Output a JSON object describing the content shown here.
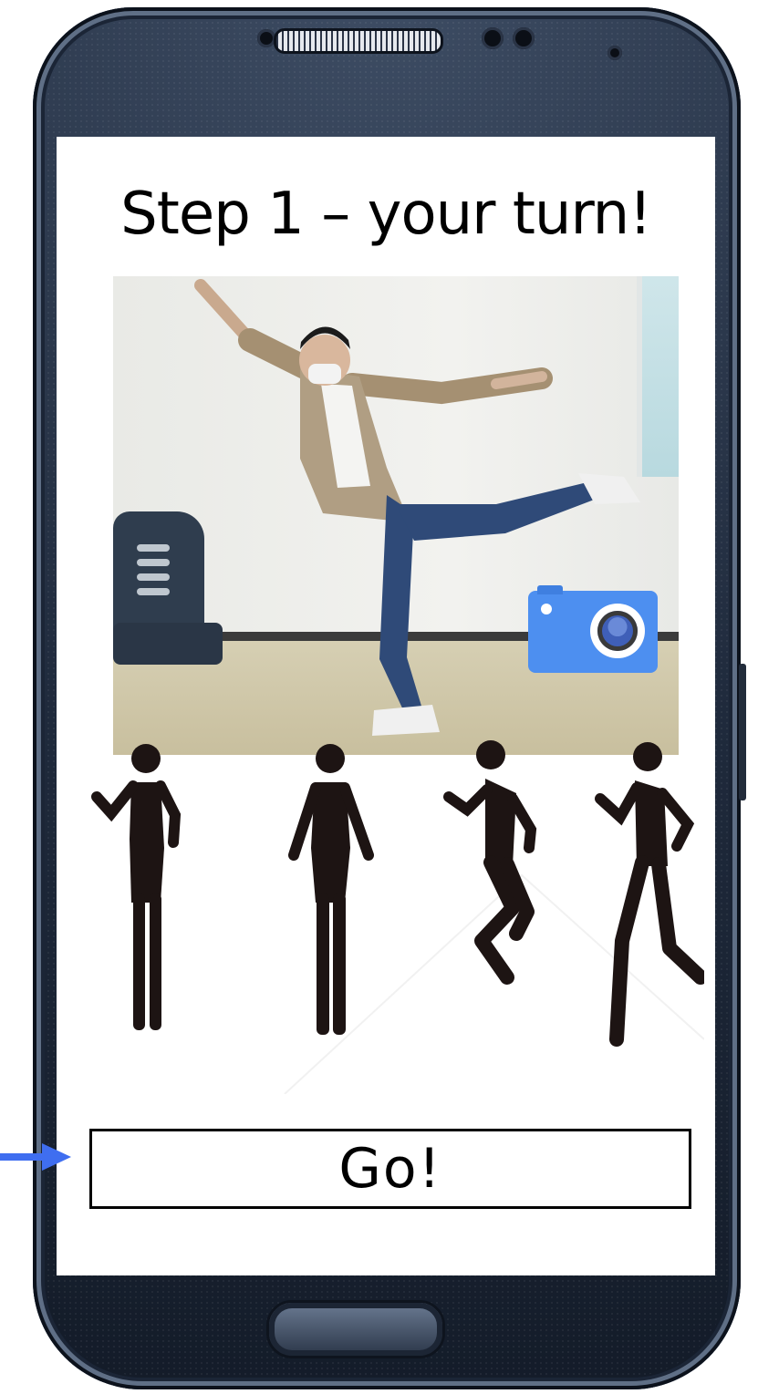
{
  "screen": {
    "title": "Step 1 – your turn!",
    "go_button_label": "Go!"
  },
  "icons": {
    "camera": "camera-icon",
    "pointer": "arrow-right-icon"
  },
  "pose_figures": [
    "figure-wave",
    "figure-stand",
    "figure-jump",
    "figure-run"
  ],
  "colors": {
    "camera_icon": "#4d8ff0",
    "pointer_arrow": "#3f6ef0",
    "phone_body": "#1f2a3c"
  }
}
